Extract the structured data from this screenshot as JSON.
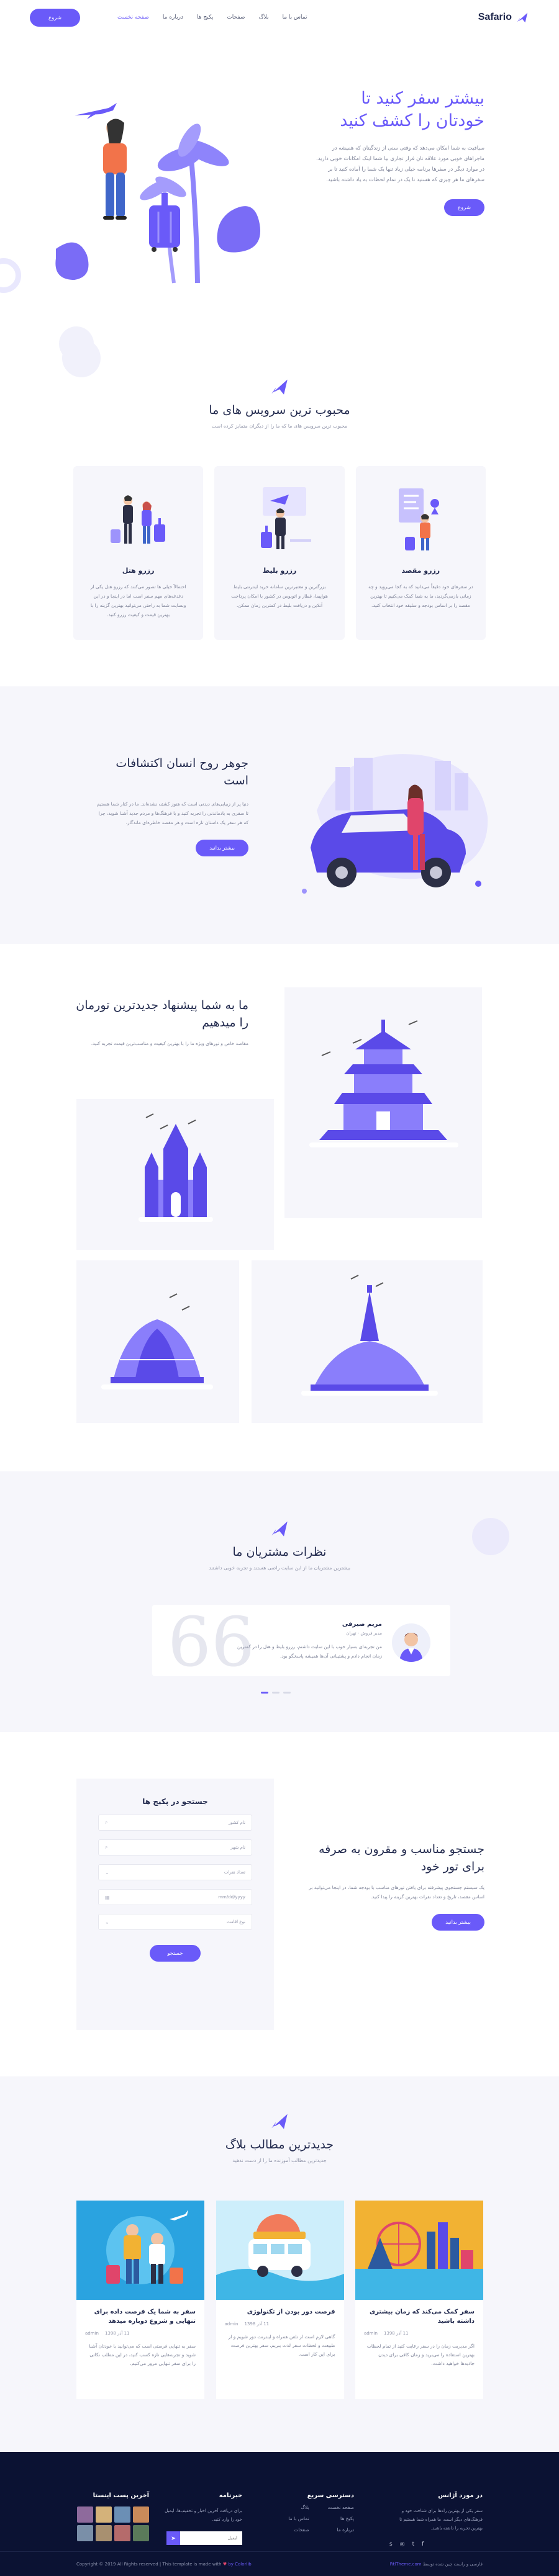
{
  "header": {
    "logo": "Safario",
    "nav": [
      {
        "label": "صفحه نخست",
        "active": true
      },
      {
        "label": "درباره ما",
        "active": false
      },
      {
        "label": "پکیج ها",
        "active": false
      },
      {
        "label": "صفحات",
        "active": false
      },
      {
        "label": "بلاگ",
        "active": false
      },
      {
        "label": "تماس با ما",
        "active": false
      }
    ],
    "cta": "شروع"
  },
  "hero": {
    "title": "بیشتر سفر کنید تا خودتان را کشف کنید",
    "desc": "سیاقیت به شما امکان می‌دهد که وقتی سنی از زندگیتان که همیشه در ماجراهای خوبی مورد علاقه تان فرار تجاری بیا شما اینک امکانات خوبی دارید. در موارد دیگر در سفرها برنامه خیلی زیاد تنها یک شما را آماده کنید تا بر سفرهای ما هر چیزی که هستید تا یک در تمام لحظات به یاد داشته باشید.",
    "button": "شروع"
  },
  "services": {
    "title": "محبوب ترین سرویس های ما",
    "subtitle": "محبوب ترین سرویس های ما که ما را از دیگران متمایز کرده است",
    "cards": [
      {
        "name": "رزرو هتل",
        "desc": "احتمالاً خیلی ها تصور می‌کنند که رزرو هتل یکی از دغدغه‌های مهم سفر است اما در اینجا و در این وبسایت شما به راحتی می‌توانید بهترین گزینه را با بهترین قیمت و کیفیت رزرو کنید."
      },
      {
        "name": "رزرو بلیط",
        "desc": "بزرگترین و معتبرترین سامانه خرید اینترنتی بلیط هواپیما، قطار و اتوبوس در کشور با امکان پرداخت آنلاین و دریافت بلیط در کمترین زمان ممکن."
      },
      {
        "name": "رزرو مقصد",
        "desc": "در سفرهای خود دقیقاً می‌دانید که به کجا می‌روید و چه زمانی بازمی‌گردید، ما به شما کمک می‌کنیم تا بهترین مقصد را بر اساس بودجه و سلیقه خود انتخاب کنید."
      }
    ]
  },
  "spirit": {
    "title": "جوهر روح انسان اکتشافات است",
    "desc": "دنیا پر از زیبایی‌های دیدنی است که هنوز کشف نشده‌اند. ما در کنار شما هستیم تا سفری به یادماندنی را تجربه کنید و با فرهنگ‌ها و مردم جدید آشنا شوید، چرا که هر سفر یک داستان تازه است و هر مقصد خاطره‌ای ماندگار.",
    "button": "بیشتر بدانید"
  },
  "tours": {
    "title": "ما به شما پیشنهاد جدیدترین تورمان را میدهیم",
    "desc": "مقاصد خاص و تورهای ویژه ما را با بهترین کیفیت و مناسب‌ترین قیمت تجربه کنید."
  },
  "testimonials": {
    "title": "نظرات مشتریان ما",
    "subtitle": "بیشترین مشتریان ما از این سایت راضی هستند و تجربه خوبی داشتند",
    "name": "مریم صیرفی",
    "role": "مدیر فروش - تهران",
    "text": "من تجربه‌ای بسیار خوب با این سایت داشتم، رزرو بلیط و هتل را در کمترین زمان انجام دادم و پشتیبانی آن‌ها همیشه پاسخگو بود.",
    "quote_mark": "66"
  },
  "search": {
    "panel_title": "جستجو در پکیج ها",
    "fields": [
      {
        "placeholder": "نام کشور",
        "icon": "⌕"
      },
      {
        "placeholder": "نام شهر",
        "icon": "⌕"
      },
      {
        "placeholder": "تعداد نفرات",
        "icon": "⌄"
      },
      {
        "placeholder": "mm/dd/yyyy",
        "icon": "▦"
      },
      {
        "placeholder": "نوع اقامت",
        "icon": "⌄"
      }
    ],
    "button": "جستجو",
    "title": "جستجو مناسب و مقرون به صرفه برای تور خود",
    "desc": "یک سیستم جستجوی پیشرفته برای یافتن تورهای مناسب با بودجه شما، در اینجا می‌توانید بر اساس مقصد، تاریخ و تعداد نفرات بهترین گزینه را پیدا کنید.",
    "cta": "بیشتر بدانید"
  },
  "blog": {
    "title": "جدیدترین مطالب بلاگ",
    "subtitle": "جدیدترین مطالب آموزنده ما را از دست ندهید",
    "posts": [
      {
        "title": "سفر به شما یک فرصت داده برای تنهایی و شروع دوباره میدهد",
        "author": "admin",
        "date": "11 آذر 1398",
        "desc": "سفر به تنهایی فرصتی است که می‌توانید با خودتان آشنا شوید و تجربه‌هایی تازه کسب کنید، در این مطلب نکاتی را برای سفر تنهایی مرور می‌کنیم."
      },
      {
        "title": "فرصت دور بودن از تکنولوژی",
        "author": "admin",
        "date": "11 آذر 1398",
        "desc": "گاهی لازم است از تلفن همراه و اینترنت دور شویم و از طبیعت و لحظات سفر لذت ببریم، سفر بهترین فرصت برای این کار است."
      },
      {
        "title": "سفر کمک می‌کند که زمان بیشتری داشته باشید",
        "author": "admin",
        "date": "11 آذر 1398",
        "desc": "اگر مدیریت زمان را در سفر رعایت کنید از تمام لحظات بهترین استفاده را می‌برید و زمان کافی برای دیدن جاذبه‌ها خواهید داشت."
      }
    ]
  },
  "footer": {
    "about_title": "در مورد آژانس",
    "about_text": "سفر یکی از بهترین راه‌ها برای شناخت خود و فرهنگ‌های دیگر است، ما همراه شما هستیم تا بهترین تجربه را داشته باشید.",
    "links_title": "دسترسی سریع",
    "links": [
      "صفحه نخست",
      "پکیج ها",
      "درباره ما",
      "بلاگ",
      "تماس با ما",
      "صفحات"
    ],
    "news_title": "خبرنامه",
    "news_text": "برای دریافت آخرین اخبار و تخفیف‌ها، ایمیل خود را وارد کنید.",
    "news_placeholder": "ایمیل",
    "insta_title": "آخرین پست اینستا",
    "copyright": "Copyright © 2019 All Rights reserved | This template is made with",
    "by": "by Colorlib",
    "credit_prefix": "فارسی و راست چین شده توسط",
    "credit_site": "RtlTheme.com"
  }
}
